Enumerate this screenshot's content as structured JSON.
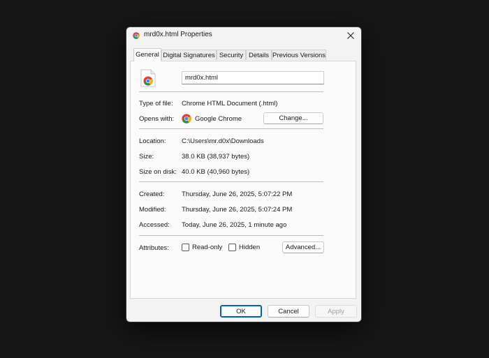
{
  "window": {
    "title": "mrd0x.html Properties",
    "icon": "chrome-icon"
  },
  "tabs": [
    {
      "label": "General",
      "active": true
    },
    {
      "label": "Digital Signatures",
      "active": false
    },
    {
      "label": "Security",
      "active": false
    },
    {
      "label": "Details",
      "active": false
    },
    {
      "label": "Previous Versions",
      "active": false
    }
  ],
  "general": {
    "file_name": "mrd0x.html",
    "type_label": "Type of file:",
    "type_value": "Chrome HTML Document (.html)",
    "opens_label": "Opens with:",
    "opens_value": "Google Chrome",
    "change_button": "Change...",
    "location_label": "Location:",
    "location_value": "C:\\Users\\mr.d0x\\Downloads",
    "size_label": "Size:",
    "size_value": "38.0 KB (38,937 bytes)",
    "size_disk_label": "Size on disk:",
    "size_disk_value": "40.0 KB (40,960 bytes)",
    "created_label": "Created:",
    "created_value": "Thursday, June 26, 2025, 5:07:22 PM",
    "modified_label": "Modified:",
    "modified_value": "Thursday, June 26, 2025, 5:07:24 PM",
    "accessed_label": "Accessed:",
    "accessed_value": "Today, June 26, 2025, 1 minute ago",
    "attributes_label": "Attributes:",
    "readonly_label": "Read-only",
    "readonly_checked": false,
    "hidden_label": "Hidden",
    "hidden_checked": false,
    "advanced_button": "Advanced..."
  },
  "footer": {
    "ok": "OK",
    "cancel": "Cancel",
    "apply": "Apply"
  },
  "colors": {
    "accent": "#005fb8",
    "background": "#161616"
  }
}
